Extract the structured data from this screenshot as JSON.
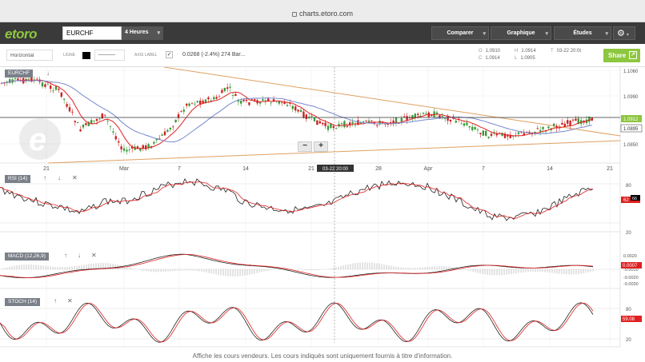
{
  "browser": {
    "url": "charts.etoro.com"
  },
  "nav": {
    "logo": "etoro",
    "symbol": "EURCHF",
    "timeframe": "4 Heures",
    "compare": "Comparer",
    "chart": "Graphique",
    "studies": "Études",
    "settings_icon": "gear-icon"
  },
  "toolbar": {
    "draw_mode": "Horizontal",
    "line_label": "LIGNE",
    "line_style": "———",
    "axis_label": "AXIS LABEL",
    "checkbox_mark": "✓",
    "quote": "0.0268 (-2.4%) 274 Bar...",
    "o_label": "O",
    "o_val": "1.0910",
    "c_label": "C",
    "c_val": "1.0914",
    "h_label": "H",
    "h_val": "1.0914",
    "l_label": "L",
    "l_val": "1.0905",
    "t_label": "T",
    "t_val": "03-22 20:0t",
    "share": "Share"
  },
  "main_panel": {
    "label": "EURCHF",
    "price_ticks": [
      "1.1060",
      "1.0990",
      "1.0850"
    ],
    "current_price": "1.0912",
    "price_badge_2": "1.0895",
    "x_ticks": [
      "21",
      "Mar",
      "7",
      "14",
      "21",
      "28",
      "Apr",
      "7",
      "14",
      "21"
    ],
    "crosshair_date": "03-22 20:00",
    "zoom_out": "−",
    "zoom_in": "+"
  },
  "rsi": {
    "label": "RSI (14)",
    "ticks": [
      "80",
      "20"
    ],
    "badge": "62",
    "badge2": "66"
  },
  "macd": {
    "label": "MACD (12,26,9)",
    "ticks": [
      "0.0020",
      "0.0000",
      "-0.0010",
      "-0.0020",
      "-0.0030"
    ],
    "badge": "0.0007"
  },
  "stoch": {
    "label": "STOCH (14)",
    "ticks": [
      "80",
      "20"
    ],
    "badge": "59.08"
  },
  "footer": {
    "text": "Affiche les cours vendeurs. Les cours indiqués sont uniquement fournis à titre d'information."
  },
  "colors": {
    "accent": "#8dc63f",
    "nav_bg": "#3a3a3a",
    "ema_red": "#e02020",
    "sma_blue": "#7788cc",
    "trend_orange": "#e0a060"
  }
}
